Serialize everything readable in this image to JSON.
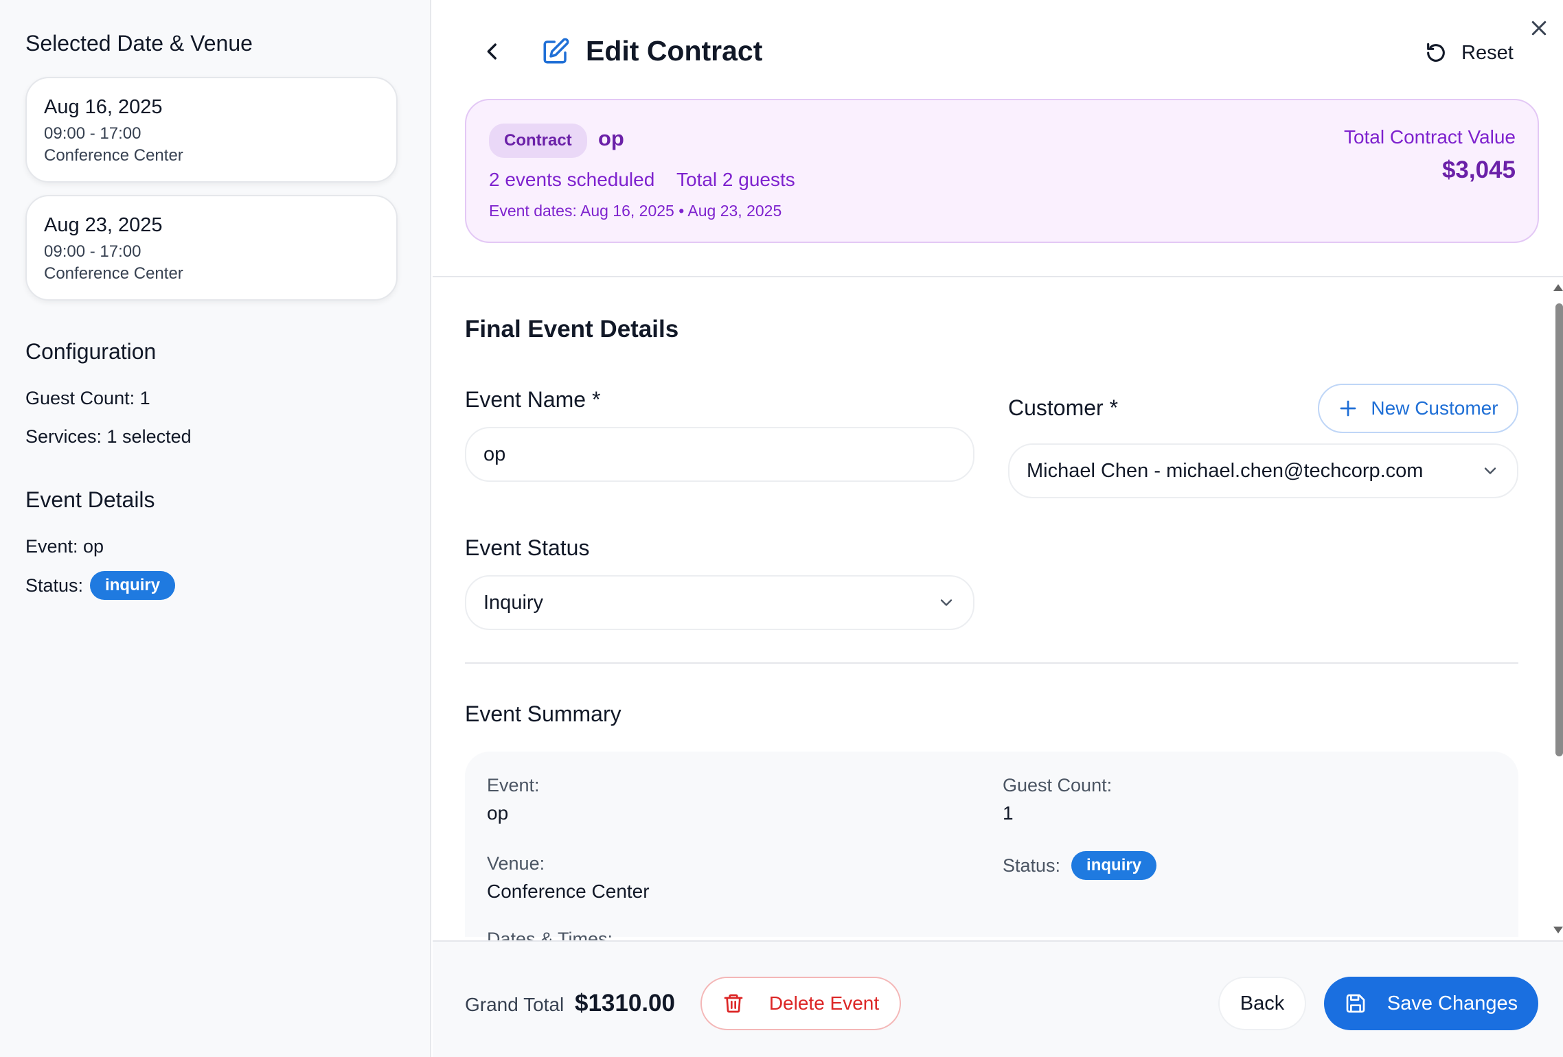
{
  "sidebar": {
    "selected_heading": "Selected Date & Venue",
    "dates": [
      {
        "date": "Aug 16, 2025",
        "time": "09:00 - 17:00",
        "venue": "Conference Center"
      },
      {
        "date": "Aug 23, 2025",
        "time": "09:00 - 17:00",
        "venue": "Conference Center"
      }
    ],
    "configuration_heading": "Configuration",
    "guest_count": "Guest Count: 1",
    "services": "Services: 1 selected",
    "event_details_heading": "Event Details",
    "event_line": "Event: op",
    "status_label": "Status:",
    "status_badge": "inquiry"
  },
  "header": {
    "title": "Edit Contract",
    "reset_label": "Reset",
    "icons": {
      "back": "chevron-left-icon",
      "edit": "edit-icon",
      "reset": "reset-icon",
      "close": "close-icon"
    }
  },
  "contract": {
    "pill": "Contract",
    "name": "op",
    "events_scheduled": "2 events scheduled",
    "total_guests": "Total 2 guests",
    "event_dates": "Event dates: Aug 16, 2025 • Aug 23, 2025",
    "total_value_label": "Total Contract Value",
    "total_value": "$3,045"
  },
  "form": {
    "section_title": "Final Event Details",
    "event_name_label": "Event Name *",
    "event_name_value": "op",
    "customer_label": "Customer *",
    "new_customer_label": "New Customer",
    "customer_value": "Michael Chen - michael.chen@techcorp.com",
    "status_label": "Event Status",
    "status_value": "Inquiry"
  },
  "summary": {
    "title": "Event Summary",
    "event_label": "Event:",
    "event_value": "op",
    "guest_count_label": "Guest Count:",
    "guest_count_value": "1",
    "venue_label": "Venue:",
    "venue_value": "Conference Center",
    "status_label": "Status:",
    "status_badge": "inquiry",
    "dates_label": "Dates & Times:"
  },
  "footer": {
    "grand_total_label": "Grand Total",
    "grand_total_value": "$1310.00",
    "delete_label": "Delete Event",
    "back_label": "Back",
    "save_label": "Save Changes"
  },
  "colors": {
    "primary": "#1a6fe0",
    "badge": "#1f7ae0",
    "contract_bg": "#faf0fe",
    "contract_text": "#6b21a8",
    "danger": "#dc2626"
  }
}
